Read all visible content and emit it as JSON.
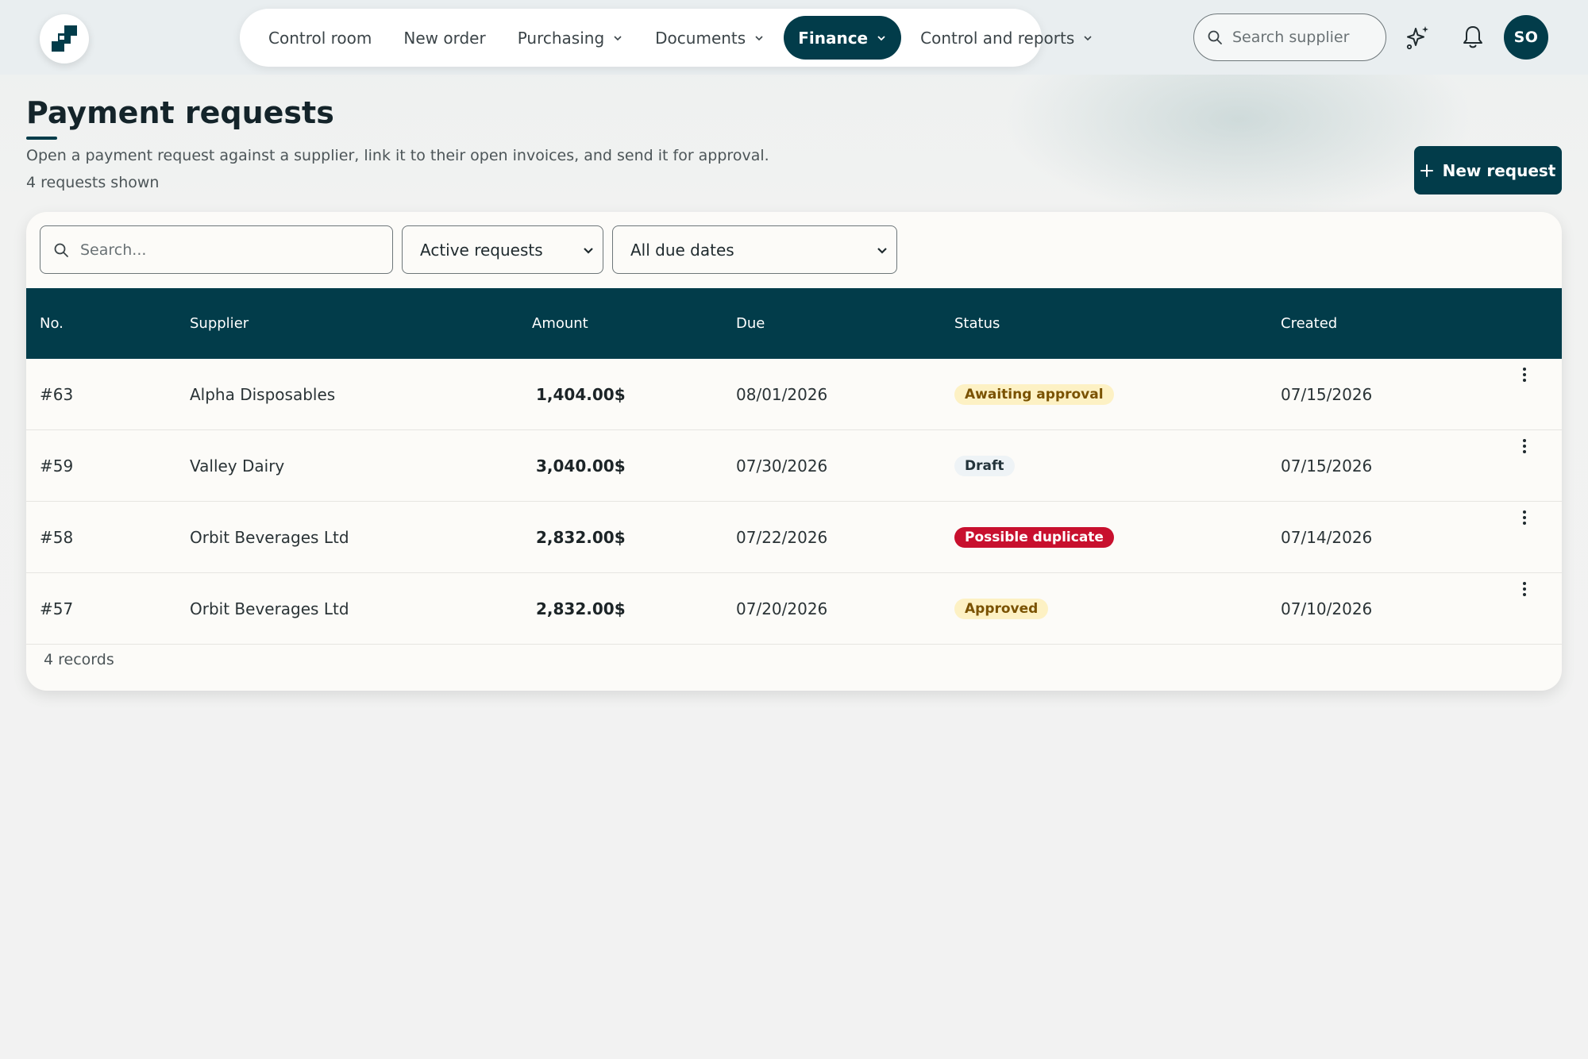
{
  "nav": {
    "items": [
      {
        "label": "Control room",
        "dropdown": false,
        "active": false
      },
      {
        "label": "New order",
        "dropdown": false,
        "active": false
      },
      {
        "label": "Purchasing",
        "dropdown": true,
        "active": false
      },
      {
        "label": "Documents",
        "dropdown": true,
        "active": false
      },
      {
        "label": "Finance",
        "dropdown": true,
        "active": true
      },
      {
        "label": "Control and reports",
        "dropdown": true,
        "active": false
      }
    ],
    "search_placeholder": "Search supplier",
    "avatar_initials": "SO"
  },
  "page": {
    "title": "Payment requests",
    "subtitle": "Open a payment request against a supplier, link it to their open invoices, and send it for approval.",
    "count_text": "4 requests shown",
    "new_request_label": "New request"
  },
  "filters": {
    "search_placeholder": "Search...",
    "status_select": "Active requests",
    "due_select": "All due dates"
  },
  "table": {
    "columns": [
      "No.",
      "Supplier",
      "Amount",
      "Due",
      "Status",
      "Created"
    ],
    "rows": [
      {
        "no": "#63",
        "supplier": "Alpha Disposables",
        "amount": "1,404.00$",
        "due": "08/01/2026",
        "status": "Awaiting approval",
        "status_kind": "warning",
        "created": "07/15/2026"
      },
      {
        "no": "#59",
        "supplier": "Valley Dairy",
        "amount": "3,040.00$",
        "due": "07/30/2026",
        "status": "Draft",
        "status_kind": "neutral",
        "created": "07/15/2026"
      },
      {
        "no": "#58",
        "supplier": "Orbit Beverages Ltd",
        "amount": "2,832.00$",
        "due": "07/22/2026",
        "status": "Possible duplicate",
        "status_kind": "danger",
        "created": "07/14/2026"
      },
      {
        "no": "#57",
        "supplier": "Orbit Beverages Ltd",
        "amount": "2,832.00$",
        "due": "07/20/2026",
        "status": "Approved",
        "status_kind": "success",
        "created": "07/10/2026"
      }
    ],
    "footer": "4 records"
  },
  "colors": {
    "primary": "#023c4a",
    "badge_warning_bg": "#fdf1c4",
    "badge_warning_fg": "#7a5200",
    "badge_neutral_bg": "#eef3f6",
    "badge_neutral_fg": "#24343b",
    "badge_danger_bg": "#c8102e",
    "badge_danger_fg": "#ffffff",
    "badge_success_bg": "#fdf1c4",
    "badge_success_fg": "#7a5200"
  },
  "icons": [
    "logo-icon",
    "chevron-down-icon",
    "search-icon",
    "sparkle-icon",
    "bell-icon",
    "plus-icon",
    "more-vertical-icon"
  ]
}
